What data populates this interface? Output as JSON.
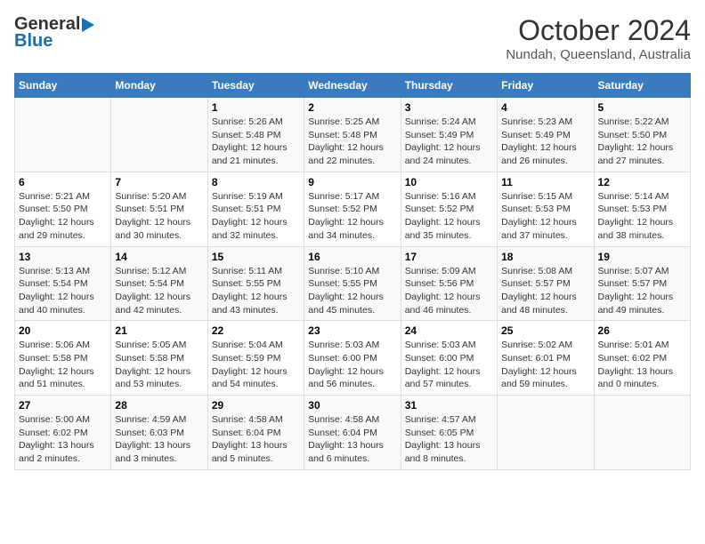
{
  "header": {
    "logo_line1": "General",
    "logo_line2": "Blue",
    "month": "October 2024",
    "location": "Nundah, Queensland, Australia"
  },
  "weekdays": [
    "Sunday",
    "Monday",
    "Tuesday",
    "Wednesday",
    "Thursday",
    "Friday",
    "Saturday"
  ],
  "weeks": [
    [
      {
        "day": "",
        "info": ""
      },
      {
        "day": "",
        "info": ""
      },
      {
        "day": "1",
        "info": "Sunrise: 5:26 AM\nSunset: 5:48 PM\nDaylight: 12 hours and 21 minutes."
      },
      {
        "day": "2",
        "info": "Sunrise: 5:25 AM\nSunset: 5:48 PM\nDaylight: 12 hours and 22 minutes."
      },
      {
        "day": "3",
        "info": "Sunrise: 5:24 AM\nSunset: 5:49 PM\nDaylight: 12 hours and 24 minutes."
      },
      {
        "day": "4",
        "info": "Sunrise: 5:23 AM\nSunset: 5:49 PM\nDaylight: 12 hours and 26 minutes."
      },
      {
        "day": "5",
        "info": "Sunrise: 5:22 AM\nSunset: 5:50 PM\nDaylight: 12 hours and 27 minutes."
      }
    ],
    [
      {
        "day": "6",
        "info": "Sunrise: 5:21 AM\nSunset: 5:50 PM\nDaylight: 12 hours and 29 minutes."
      },
      {
        "day": "7",
        "info": "Sunrise: 5:20 AM\nSunset: 5:51 PM\nDaylight: 12 hours and 30 minutes."
      },
      {
        "day": "8",
        "info": "Sunrise: 5:19 AM\nSunset: 5:51 PM\nDaylight: 12 hours and 32 minutes."
      },
      {
        "day": "9",
        "info": "Sunrise: 5:17 AM\nSunset: 5:52 PM\nDaylight: 12 hours and 34 minutes."
      },
      {
        "day": "10",
        "info": "Sunrise: 5:16 AM\nSunset: 5:52 PM\nDaylight: 12 hours and 35 minutes."
      },
      {
        "day": "11",
        "info": "Sunrise: 5:15 AM\nSunset: 5:53 PM\nDaylight: 12 hours and 37 minutes."
      },
      {
        "day": "12",
        "info": "Sunrise: 5:14 AM\nSunset: 5:53 PM\nDaylight: 12 hours and 38 minutes."
      }
    ],
    [
      {
        "day": "13",
        "info": "Sunrise: 5:13 AM\nSunset: 5:54 PM\nDaylight: 12 hours and 40 minutes."
      },
      {
        "day": "14",
        "info": "Sunrise: 5:12 AM\nSunset: 5:54 PM\nDaylight: 12 hours and 42 minutes."
      },
      {
        "day": "15",
        "info": "Sunrise: 5:11 AM\nSunset: 5:55 PM\nDaylight: 12 hours and 43 minutes."
      },
      {
        "day": "16",
        "info": "Sunrise: 5:10 AM\nSunset: 5:55 PM\nDaylight: 12 hours and 45 minutes."
      },
      {
        "day": "17",
        "info": "Sunrise: 5:09 AM\nSunset: 5:56 PM\nDaylight: 12 hours and 46 minutes."
      },
      {
        "day": "18",
        "info": "Sunrise: 5:08 AM\nSunset: 5:57 PM\nDaylight: 12 hours and 48 minutes."
      },
      {
        "day": "19",
        "info": "Sunrise: 5:07 AM\nSunset: 5:57 PM\nDaylight: 12 hours and 49 minutes."
      }
    ],
    [
      {
        "day": "20",
        "info": "Sunrise: 5:06 AM\nSunset: 5:58 PM\nDaylight: 12 hours and 51 minutes."
      },
      {
        "day": "21",
        "info": "Sunrise: 5:05 AM\nSunset: 5:58 PM\nDaylight: 12 hours and 53 minutes."
      },
      {
        "day": "22",
        "info": "Sunrise: 5:04 AM\nSunset: 5:59 PM\nDaylight: 12 hours and 54 minutes."
      },
      {
        "day": "23",
        "info": "Sunrise: 5:03 AM\nSunset: 6:00 PM\nDaylight: 12 hours and 56 minutes."
      },
      {
        "day": "24",
        "info": "Sunrise: 5:03 AM\nSunset: 6:00 PM\nDaylight: 12 hours and 57 minutes."
      },
      {
        "day": "25",
        "info": "Sunrise: 5:02 AM\nSunset: 6:01 PM\nDaylight: 12 hours and 59 minutes."
      },
      {
        "day": "26",
        "info": "Sunrise: 5:01 AM\nSunset: 6:02 PM\nDaylight: 13 hours and 0 minutes."
      }
    ],
    [
      {
        "day": "27",
        "info": "Sunrise: 5:00 AM\nSunset: 6:02 PM\nDaylight: 13 hours and 2 minutes."
      },
      {
        "day": "28",
        "info": "Sunrise: 4:59 AM\nSunset: 6:03 PM\nDaylight: 13 hours and 3 minutes."
      },
      {
        "day": "29",
        "info": "Sunrise: 4:58 AM\nSunset: 6:04 PM\nDaylight: 13 hours and 5 minutes."
      },
      {
        "day": "30",
        "info": "Sunrise: 4:58 AM\nSunset: 6:04 PM\nDaylight: 13 hours and 6 minutes."
      },
      {
        "day": "31",
        "info": "Sunrise: 4:57 AM\nSunset: 6:05 PM\nDaylight: 13 hours and 8 minutes."
      },
      {
        "day": "",
        "info": ""
      },
      {
        "day": "",
        "info": ""
      }
    ]
  ]
}
